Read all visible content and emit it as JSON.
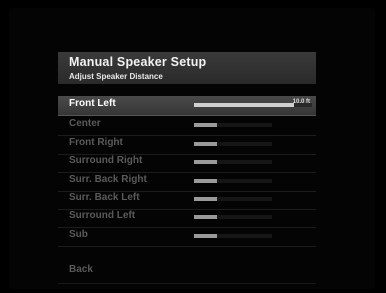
{
  "header": {
    "title": "Manual Speaker Setup",
    "subtitle": "Adjust Speaker Distance"
  },
  "speakers": [
    {
      "label": "Front Left",
      "value": "10.0 ft",
      "level": 0.85,
      "selected": true
    },
    {
      "label": "Center",
      "value": "",
      "level": 0.3,
      "selected": false
    },
    {
      "label": "Front Right",
      "value": "",
      "level": 0.3,
      "selected": false
    },
    {
      "label": "Surround Right",
      "value": "",
      "level": 0.3,
      "selected": false
    },
    {
      "label": "Surr. Back Right",
      "value": "",
      "level": 0.3,
      "selected": false
    },
    {
      "label": "Surr. Back Left",
      "value": "",
      "level": 0.3,
      "selected": false
    },
    {
      "label": "Surround Left",
      "value": "",
      "level": 0.3,
      "selected": false
    },
    {
      "label": "Sub",
      "value": "",
      "level": 0.3,
      "selected": false
    }
  ],
  "footer": {
    "back_label": "Back"
  }
}
